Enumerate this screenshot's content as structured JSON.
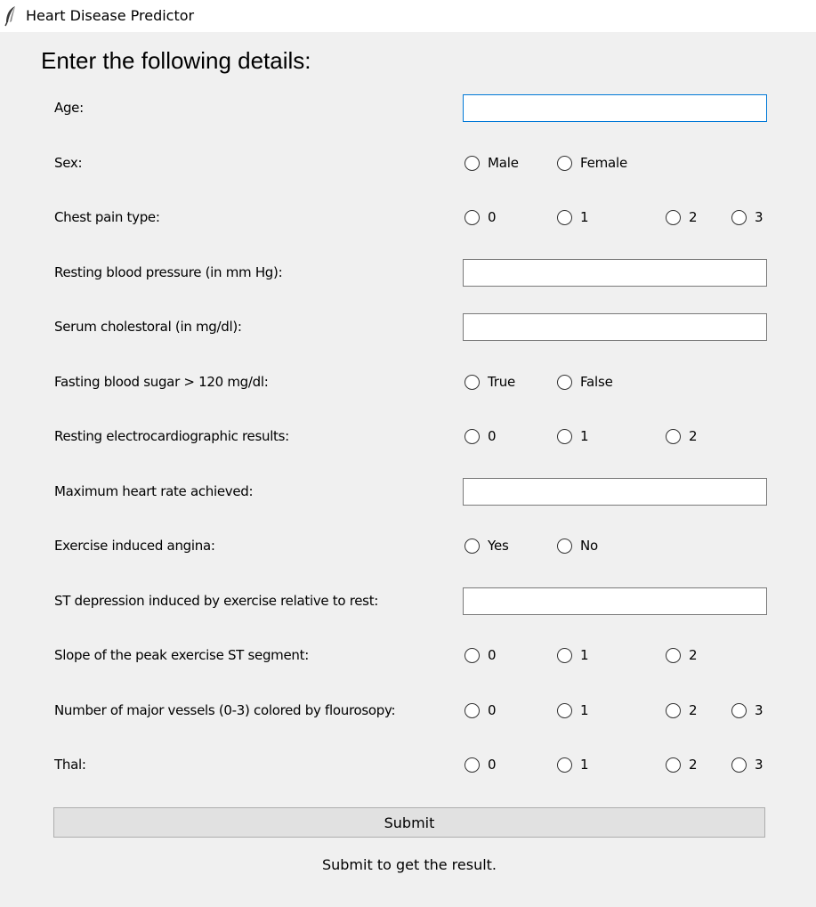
{
  "window": {
    "title": "Heart Disease Predictor",
    "icon": "feather-icon"
  },
  "form": {
    "heading": "Enter the following details:",
    "fields": [
      {
        "key": "age",
        "label": "Age:",
        "type": "entry",
        "value": "",
        "focused": true
      },
      {
        "key": "sex",
        "label": "Sex:",
        "type": "radio",
        "options": [
          "Male",
          "Female"
        ]
      },
      {
        "key": "cp",
        "label": "Chest pain type:",
        "type": "radio",
        "options": [
          "0",
          "1",
          "2",
          "3"
        ]
      },
      {
        "key": "trestbps",
        "label": "Resting blood pressure (in mm Hg):",
        "type": "entry",
        "value": ""
      },
      {
        "key": "chol",
        "label": "Serum cholestoral (in mg/dl):",
        "type": "entry",
        "value": ""
      },
      {
        "key": "fbs",
        "label": "Fasting blood sugar > 120 mg/dl:",
        "type": "radio",
        "options": [
          "True",
          "False"
        ]
      },
      {
        "key": "restecg",
        "label": "Resting electrocardiographic results:",
        "type": "radio",
        "options": [
          "0",
          "1",
          "2"
        ]
      },
      {
        "key": "thalach",
        "label": "Maximum heart rate achieved:",
        "type": "entry",
        "value": ""
      },
      {
        "key": "exang",
        "label": "Exercise induced angina:",
        "type": "radio",
        "options": [
          "Yes",
          "No"
        ]
      },
      {
        "key": "oldpeak",
        "label": "ST depression induced by exercise relative to rest:",
        "type": "entry",
        "value": ""
      },
      {
        "key": "slope",
        "label": "Slope of the peak exercise ST segment:",
        "type": "radio",
        "options": [
          "0",
          "1",
          "2"
        ]
      },
      {
        "key": "ca",
        "label": "Number of major vessels (0-3) colored by flourosopy:",
        "type": "radio",
        "options": [
          "0",
          "1",
          "2",
          "3"
        ]
      },
      {
        "key": "thal",
        "label": "Thal:",
        "type": "radio",
        "options": [
          "0",
          "1",
          "2",
          "3"
        ]
      }
    ],
    "submit_label": "Submit",
    "result_text": "Submit to get the result."
  }
}
